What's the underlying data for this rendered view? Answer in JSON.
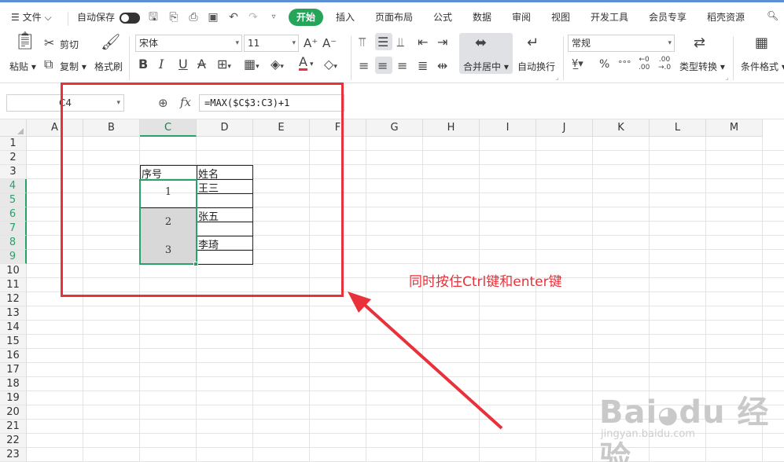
{
  "menubar": {
    "file": "文件",
    "autosave": "自动保存",
    "tabs": [
      "开始",
      "插入",
      "页面布局",
      "公式",
      "数据",
      "审阅",
      "视图",
      "开发工具",
      "会员专享",
      "稻壳资源"
    ]
  },
  "ribbon": {
    "paste": "粘贴",
    "cut": "剪切",
    "copy": "复制",
    "format_painter": "格式刷",
    "font_name": "宋体",
    "font_size": "11",
    "merge_center": "合并居中",
    "wrap_text": "自动换行",
    "number_format": "常规",
    "type_convert": "类型转换",
    "conditional_format": "条件格式"
  },
  "formula_bar": {
    "cell_ref": "C4",
    "formula": "=MAX($C$3:C3)+1"
  },
  "sheet": {
    "columns": [
      "A",
      "B",
      "C",
      "D",
      "E",
      "F",
      "G",
      "H",
      "I",
      "J",
      "K",
      "L",
      "M"
    ],
    "selected_column": "C",
    "row_count": 23,
    "selected_rows": [
      4,
      5,
      6,
      7,
      8,
      9
    ],
    "headers": [
      "序号",
      "姓名"
    ],
    "rows": [
      {
        "seq": "1",
        "name": "王三"
      },
      {
        "seq": "2",
        "name": "张五"
      },
      {
        "seq": "3",
        "name": "李琦"
      }
    ]
  },
  "annotation": {
    "text": "同时按住Ctrl键和enter键",
    "color": "#e8313a"
  },
  "colors": {
    "accent_green": "#25a55a",
    "annotation_red": "#e8313a"
  }
}
